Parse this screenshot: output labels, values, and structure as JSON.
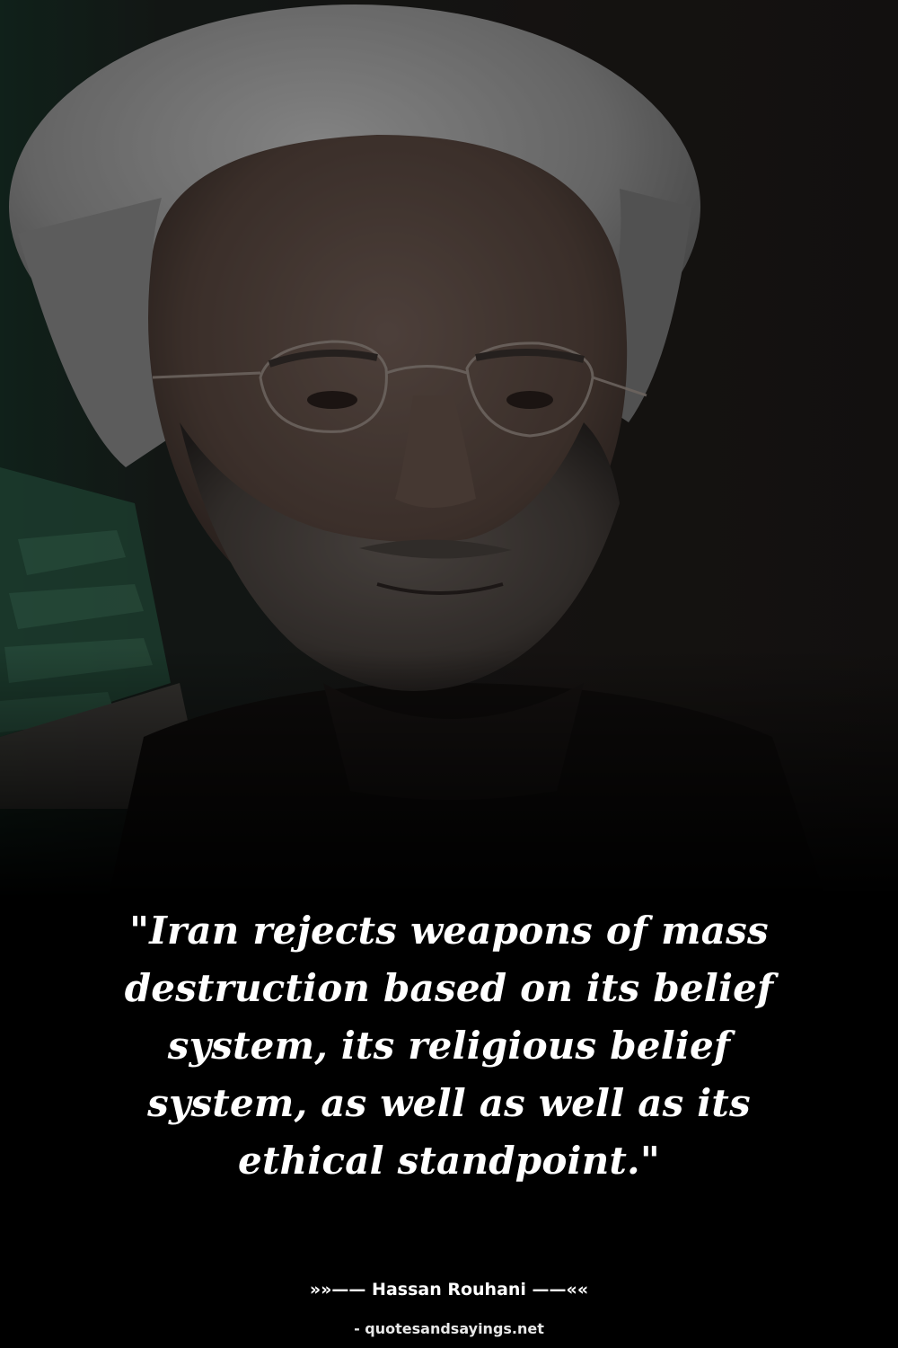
{
  "quote": {
    "lines": [
      "\"Iran rejects weapons of mass",
      "destruction based on its belief",
      "system, its religious belief",
      "system, as well as well as its",
      "ethical standpoint.\""
    ]
  },
  "attribution": {
    "author": "»»—— Hassan Rouhani ——««"
  },
  "footer": {
    "source": "- quotesandsayings.net"
  },
  "colors": {
    "background": "#000000",
    "text": "#ffffff",
    "flag_green": "#1f4a36",
    "turban": "#bdbdbd",
    "skin": "#6e5a4e"
  }
}
